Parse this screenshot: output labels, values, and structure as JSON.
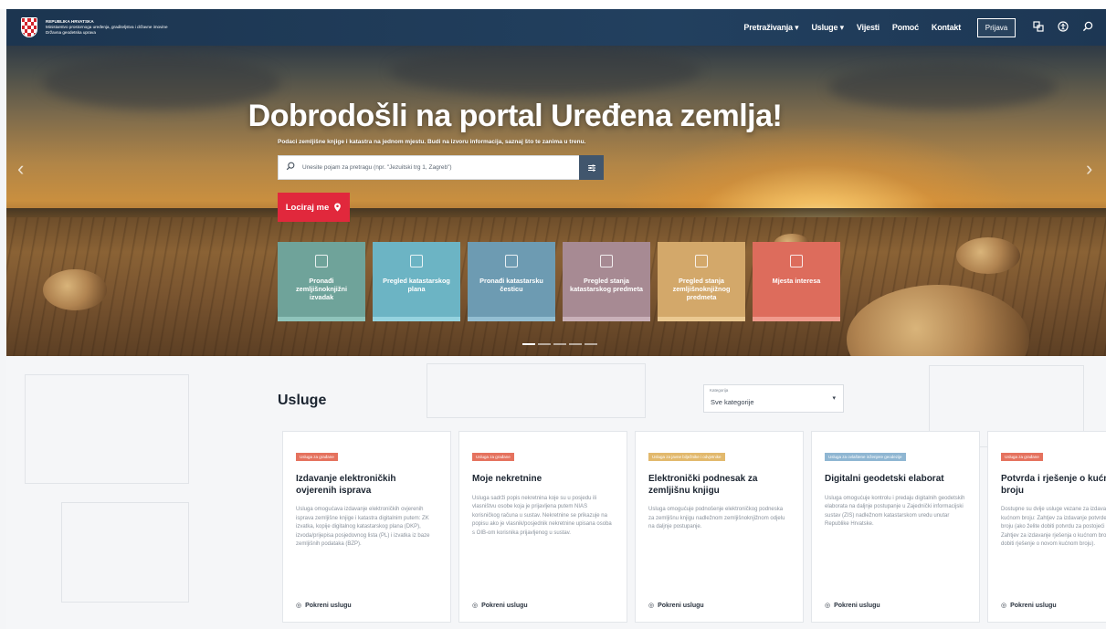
{
  "header": {
    "logo_line1": "REPUBLIKA HRVATSKA",
    "logo_line2": "Ministarstvo prostornoga uređenja, graditeljstva i državne imovine",
    "logo_line3": "Državna geodetska uprava",
    "nav": [
      {
        "label": "Pretraživanja ▾"
      },
      {
        "label": "Usluge ▾"
      },
      {
        "label": "Vijesti"
      },
      {
        "label": "Pomoć"
      },
      {
        "label": "Kontakt"
      }
    ],
    "login_label": "Prijava",
    "icons": [
      "translate-icon",
      "accessibility-icon",
      "search-icon"
    ]
  },
  "hero": {
    "title": "Dobrodošli na portal Uređena zemlja!",
    "subtitle": "Podaci zemljišne knjige i katastra na jednom mjestu. Budi na izvoru informacija, saznaj što te zanima u trenu.",
    "search_placeholder": "Unesite pojam za pretragu (npr. \"Jezuitski trg 1, Zagreb\")",
    "locate_label": "Lociraj me",
    "tiles": [
      {
        "label": "Pronađi zemljišnoknjižni izvadak",
        "color": "#6fa39a",
        "bar": "#8fc4bb"
      },
      {
        "label": "Pregled katastarskog plana",
        "color": "#6cb4c4",
        "bar": "#95d3df"
      },
      {
        "label": "Pronađi katastarsku česticu",
        "color": "#6d9bb2",
        "bar": "#93bed2"
      },
      {
        "label": "Pregled stanja katastarskog predmeta",
        "color": "#a78a93",
        "bar": "#c9b0b8"
      },
      {
        "label": "Pregled stanja zemljišnoknjižnog predmeta",
        "color": "#d3a86a",
        "bar": "#ebc991"
      },
      {
        "label": "Mjesta interesa",
        "color": "#dd6c5c",
        "bar": "#f09a8c"
      }
    ],
    "slides": 5,
    "active_slide": 1
  },
  "services": {
    "title": "Usluge",
    "category_label": "Kategorija",
    "category_value": "Sve kategorije",
    "cards": [
      {
        "badge": "Usluga za građane",
        "badge_color": "#e5725e",
        "title": "Izdavanje elektroničkih ovjerenih isprava",
        "desc": "Usluga omogućava izdavanje elektroničkih ovjerenih isprava zemljišne knjige i katastra digitalnim putem: ZK izvatka, kopije digitalnog katastarskog plana (DKP), izvoda/prijepisa posjedovnog lista (PL) i izvatka iz baze zemljišnih podataka (BZP).",
        "link": "Pokreni uslugu"
      },
      {
        "badge": "Usluga za građane",
        "badge_color": "#e5725e",
        "title": "Moje nekretnine",
        "desc": "Usluga sadrži popis nekretnina koje su u posjedu ili vlasništvu osobe koja je prijavljena putem NIAS korisničkog računa u sustav. Nekretnine se prikazuje na popisu ako je vlasnik/posjednik nekretnine upisana osoba s OIB-om korisnika prijavljenog u sustav.",
        "link": "Pokreni uslugu"
      },
      {
        "badge": "Usluga za javne bilježnike i odvjetnike",
        "badge_color": "#e2b96d",
        "title": "Elektronički podnesak za zemljišnu knjigu",
        "desc": "Usluga omogućuje podnošenje elektroničkog podneska za zemljišnu knjigu nadležnom zemljišnoknjižnom odjelu na daljnje postupanje.",
        "link": "Pokreni uslugu"
      },
      {
        "badge": "Usluga za ovlaštene inženjere geodezije",
        "badge_color": "#8fb6d2",
        "title": "Digitalni geodetski elaborat",
        "desc": "Usluga omogućuje kontrolu i predaju digitalnih geodetskih elaborata na daljnje postupanje u Zajednički informacijski sustav (ZIS) nadležnom katastarskom uredu unutar Republike Hrvatske.",
        "link": "Pokreni uslugu"
      },
      {
        "badge": "Usluga za građane",
        "badge_color": "#e5725e",
        "title": "Potvrda i rješenje o kućnom broju",
        "desc": "Dostupne su dvije usluge vezane za izdavanje podataka o kućnom broju: Zahtjev za izdavanje potvrde o kućnom broju (ako želite dobiti potvrdu za postojeći kućni broj) i Zahtjev za izdavanje rješenja o kućnom broju (ako želite dobiti rješenje o novom kućnom broju).",
        "link": "Pokreni uslugu"
      }
    ]
  }
}
